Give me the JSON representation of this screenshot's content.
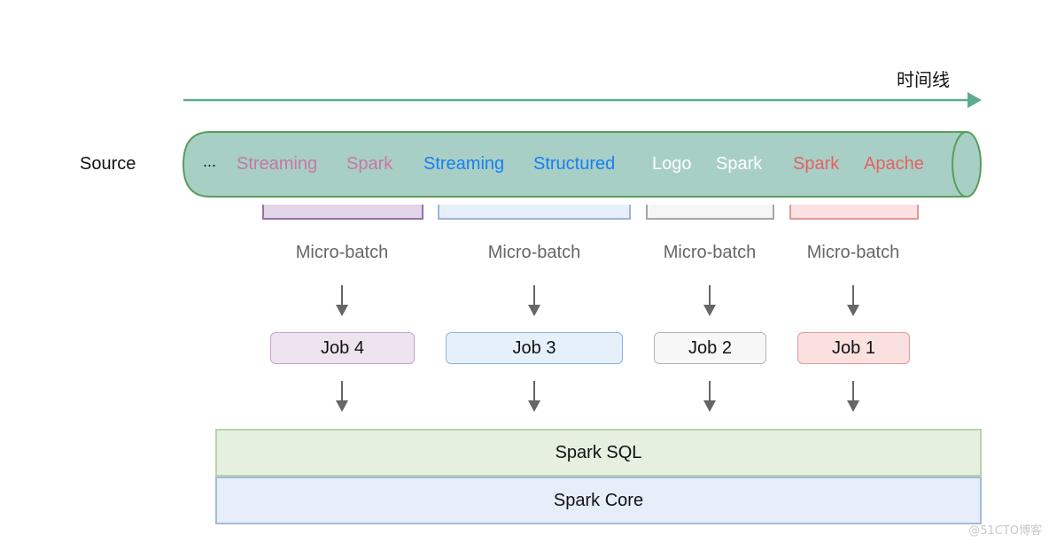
{
  "timeline": {
    "label": "时间线",
    "color": "#5bab8f"
  },
  "source": {
    "label": "Source",
    "pipe": {
      "fill": "#a7cfc6",
      "stroke": "#5a9e58",
      "ellipsis": "...",
      "words": [
        {
          "text": "Streaming",
          "color": "#c976a1"
        },
        {
          "text": "Spark",
          "color": "#c976a1"
        },
        {
          "text": "Streaming",
          "color": "#1a7ef0"
        },
        {
          "text": "Structured",
          "color": "#1a7ef0"
        },
        {
          "text": "Logo",
          "color": "#ffffff"
        },
        {
          "text": "Spark",
          "color": "#ffffff"
        },
        {
          "text": "Spark",
          "color": "#e8615e"
        },
        {
          "text": "Apache",
          "color": "#e8615e"
        }
      ]
    }
  },
  "batches": [
    {
      "micro_label": "Micro-batch",
      "job": "Job 4",
      "fill": "#e1d5e7",
      "stroke": "#9673a6",
      "job_fill": "#ede4f0",
      "job_stroke": "#c3a4cf"
    },
    {
      "micro_label": "Micro-batch",
      "job": "Job 3",
      "fill": "#e6eff9",
      "stroke": "#9fb4d8",
      "job_fill": "#e6f0fb",
      "job_stroke": "#8eb3d8"
    },
    {
      "micro_label": "Micro-batch",
      "job": "Job 2",
      "fill": "#f6f6f6",
      "stroke": "#a6a6a6",
      "job_fill": "#f7f7f7",
      "job_stroke": "#b3b3b3"
    },
    {
      "micro_label": "Micro-batch",
      "job": "Job 1",
      "fill": "#fbe1e1",
      "stroke": "#e09a9a",
      "job_fill": "#fbe0e0",
      "job_stroke": "#e59a9a"
    }
  ],
  "layers": [
    {
      "label": "Spark SQL",
      "fill": "#e5f0e1",
      "stroke": "#b7d3a8"
    },
    {
      "label": "Spark Core",
      "fill": "#e6eefa",
      "stroke": "#a4bcd8"
    }
  ],
  "watermark": "@51CTO博客"
}
